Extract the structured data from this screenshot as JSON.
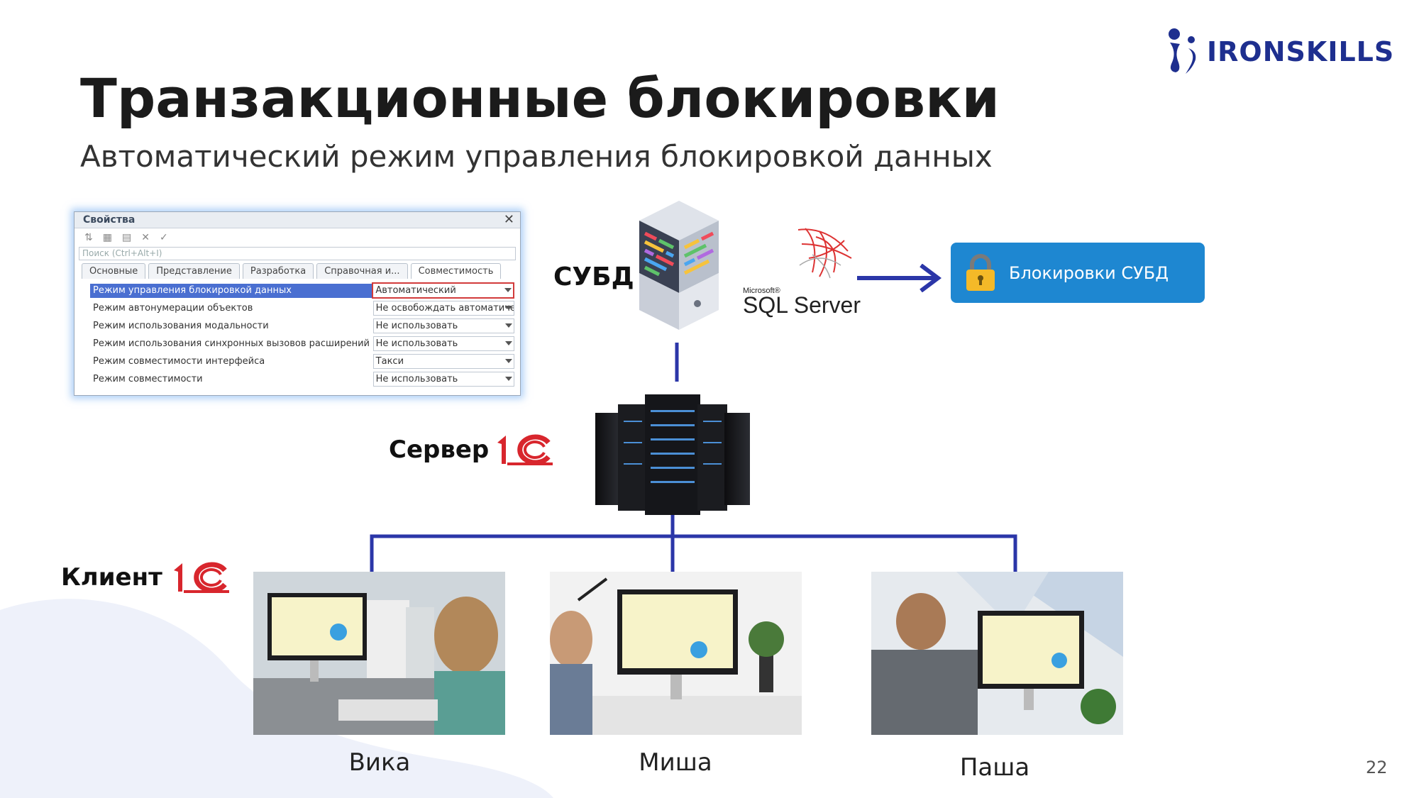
{
  "brand": {
    "name": "IRONSKILLS",
    "color": "#1e2f8f"
  },
  "title": "Транзакционные блокировки",
  "subtitle": "Автоматический режим управления блокировкой данных",
  "properties_window": {
    "title": "Свойства",
    "search_placeholder": "Поиск (Ctrl+Alt+I)",
    "tabs": [
      "Основные",
      "Представление",
      "Разработка",
      "Справочная и...",
      "Совместимость"
    ],
    "active_tab": "Совместимость",
    "rows": [
      {
        "label": "Режим управления блокировкой данных",
        "value": "Автоматический",
        "selected": true
      },
      {
        "label": "Режим автонумерации объектов",
        "value": "Не освобождать автоматиче"
      },
      {
        "label": "Режим использования модальности",
        "value": "Не использовать"
      },
      {
        "label": "Режим использования синхронных вызовов расширений плат",
        "value": "Не использовать"
      },
      {
        "label": "Режим совместимости интерфейса",
        "value": "Такси"
      },
      {
        "label": "Режим совместимости",
        "value": "Не использовать"
      }
    ]
  },
  "dbms": {
    "label": "СУБД",
    "sql_vendor": "Microsoft®",
    "sql_product": "SQL Server"
  },
  "locks_box": {
    "label": "Блокировки СУБД",
    "icon": "lock-icon",
    "color": "#1e87d1"
  },
  "server": {
    "label": "Сервер"
  },
  "client": {
    "label": "Клиент"
  },
  "users": [
    {
      "name": "Вика"
    },
    {
      "name": "Миша"
    },
    {
      "name": "Паша"
    }
  ],
  "page_number": "22",
  "colors": {
    "line": "#2b36a8",
    "onec_red": "#d8262d"
  }
}
